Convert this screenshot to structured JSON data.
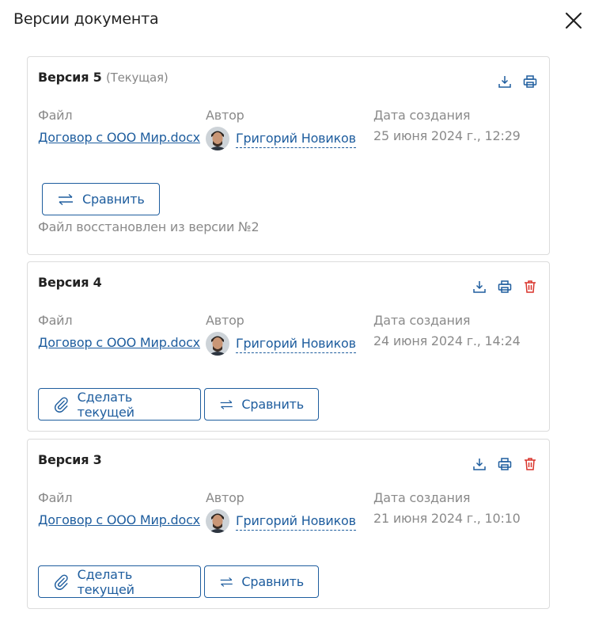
{
  "header": {
    "title": "Версии документа"
  },
  "labels": {
    "file": "Файл",
    "author": "Автор",
    "date": "Дата создания",
    "compare": "Сравнить",
    "make_current": "Сделать текущей"
  },
  "versions": [
    {
      "title": "Версия 5",
      "current_tag": "(Текущая)",
      "file_name": "Договор с ООО Мир.docx",
      "author_name": "Григорий Новиков",
      "date": "25 июня 2024 г., 12:29",
      "note": "Файл восстановлен из версии №2"
    },
    {
      "title": "Версия 4",
      "file_name": "Договор с ООО Мир.docx",
      "author_name": "Григорий Новиков",
      "date": "24 июня 2024 г., 14:24"
    },
    {
      "title": "Версия 3",
      "file_name": "Договор с ООО Мир.docx",
      "author_name": "Григорий Новиков",
      "date": "21 июня 2024 г., 10:10"
    }
  ],
  "icons": {
    "close": "close-icon",
    "download": "download-icon",
    "print": "print-icon",
    "delete": "trash-icon",
    "compare": "swap-arrows-icon",
    "make_current": "paperclip-icon"
  },
  "colors": {
    "accent": "#1e5d9e",
    "danger": "#d9342b",
    "muted": "#8a8a8a",
    "border": "#dcdcdc"
  }
}
